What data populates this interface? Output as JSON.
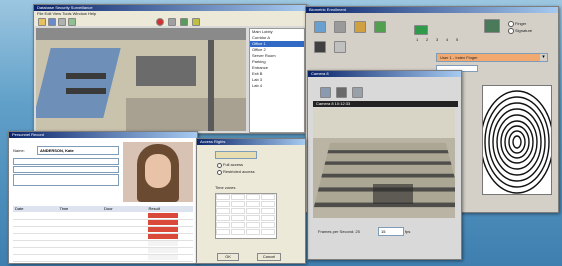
{
  "surveillance_window": {
    "title": "Database Security Surveillance",
    "menu": "File  Edit  View  Tools  Window  Help",
    "list_items": [
      "Main Lobby",
      "Corridor A",
      "Office 1",
      "Office 2",
      "Server Room",
      "Parking",
      "Entrance",
      "Exit B",
      "Lab 3",
      "Lab 4"
    ]
  },
  "biometric_window": {
    "title": "Biometric Enrollment",
    "radio_options": [
      "Finger",
      "Signature"
    ],
    "dropdown_value": "User 1 - Index Finger",
    "grid_labels": [
      "1",
      "2",
      "3",
      "4",
      "5"
    ]
  },
  "camera_window": {
    "title": "Camera 8",
    "status_bar": "Camera 8  10:12:33",
    "footer_label": "Frames per Second: 25",
    "footer_value": "15",
    "footer_unit": "fps"
  },
  "personnel_window": {
    "title": "Personnel Record",
    "name_label": "Name:",
    "name_value": "ANDERSON, Kate",
    "table_header": [
      "Date",
      "Time",
      "Door",
      "Result"
    ]
  },
  "access_window": {
    "panel_title": "Access Rights",
    "radio_a": "Full access",
    "radio_b": "Restricted access",
    "time_table_title": "Time zones",
    "ok_label": "OK",
    "cancel_label": "Cancel"
  }
}
